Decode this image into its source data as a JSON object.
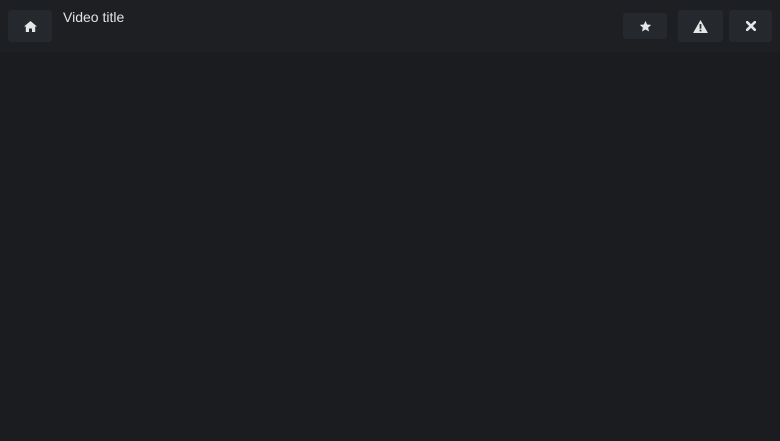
{
  "header": {
    "title": "Video title",
    "buttons": {
      "home": "home-icon",
      "favorite": "star-icon",
      "report": "warning-icon",
      "close": "close-icon"
    }
  },
  "colors": {
    "background": "#1a1c20",
    "topbar": "#1d1f23",
    "button": "#25282d",
    "text": "#e2e2e2"
  }
}
